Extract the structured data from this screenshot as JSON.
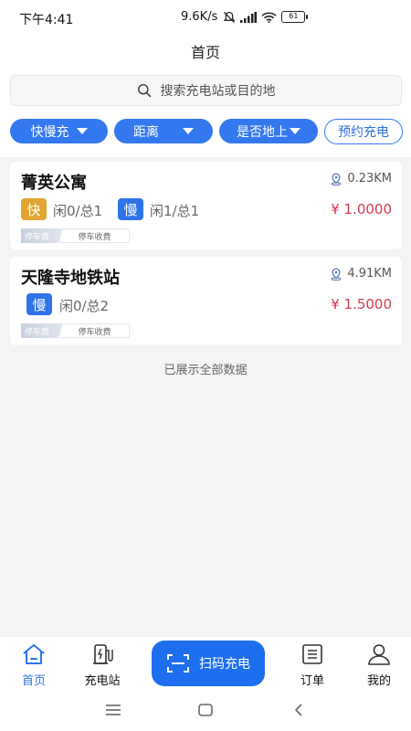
{
  "status": {
    "time": "下午4:41",
    "speed": "9.6K/s",
    "battery": "61"
  },
  "header": {
    "title": "首页"
  },
  "search": {
    "placeholder": "搜索充电站或目的地"
  },
  "filters": [
    {
      "label": "快慢充"
    },
    {
      "label": "距离"
    },
    {
      "label": "是否地上"
    }
  ],
  "reserve_label": "预约充电",
  "stations": [
    {
      "name": "菁英公寓",
      "distance": "0.23KM",
      "fast_badge": "快",
      "fast_counts": "闲0/总1",
      "slow_badge": "慢",
      "slow_counts": "闲1/总1",
      "price": "¥ 1.0000",
      "fee_label": "停车费",
      "fee_value": "停车收费"
    },
    {
      "name": "天隆寺地铁站",
      "distance": "4.91KM",
      "slow_badge": "慢",
      "slow_counts": "闲0/总2",
      "price": "¥ 1.5000",
      "fee_label": "停车费",
      "fee_value": "停车收费"
    }
  ],
  "footer_note": "已展示全部数据",
  "tabs": [
    {
      "label": "首页",
      "icon": "home-icon"
    },
    {
      "label": "充电站",
      "icon": "charging-station-icon"
    },
    {
      "label": "订单",
      "icon": "order-list-icon"
    },
    {
      "label": "我的",
      "icon": "user-icon"
    }
  ],
  "scan": {
    "label": "扫码充电",
    "icon": "scan-icon"
  },
  "colors": {
    "accent": "#2e74e8",
    "fast": "#e2a532",
    "price": "#d23a4f"
  }
}
